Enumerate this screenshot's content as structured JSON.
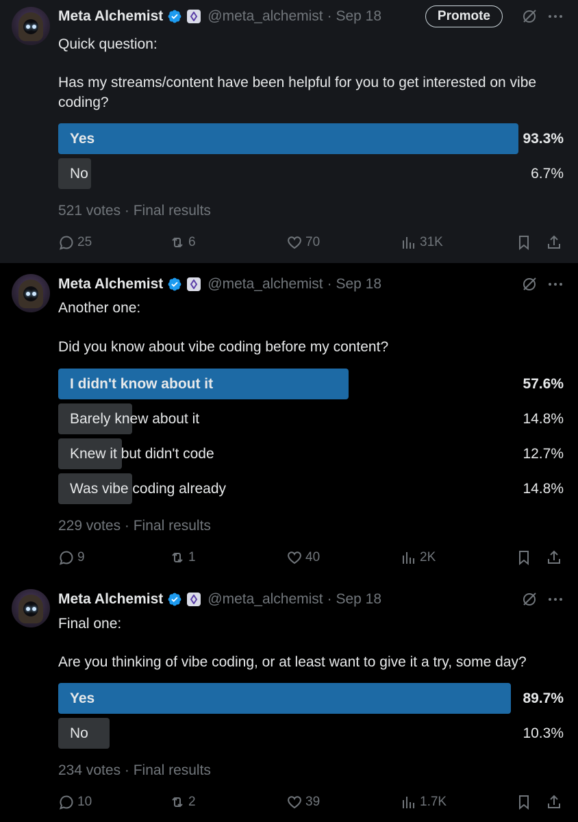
{
  "tweets": [
    {
      "author": {
        "name": "Meta Alchemist",
        "handle": "@meta_alchemist",
        "date": "· Sep 18"
      },
      "promote_label": "Promote",
      "text": [
        "Quick question:",
        "Has my streams/content have been helpful for you to get interested on vibe coding?"
      ],
      "poll": {
        "options": [
          {
            "label": "Yes",
            "percent_text": "93.3%",
            "percent": 93.3,
            "winner": true
          },
          {
            "label": "No",
            "percent_text": "6.7%",
            "percent": 6.7,
            "winner": false
          }
        ],
        "summary": "521 votes · Final results"
      },
      "stats": {
        "replies": "25",
        "reposts": "6",
        "likes": "70",
        "views": "31K"
      }
    },
    {
      "author": {
        "name": "Meta Alchemist",
        "handle": "@meta_alchemist",
        "date": "· Sep 18"
      },
      "text": [
        "Another one:",
        "Did you know about vibe coding before my content?"
      ],
      "poll": {
        "options": [
          {
            "label": "I didn't know about it",
            "percent_text": "57.6%",
            "percent": 57.6,
            "winner": true
          },
          {
            "label": "Barely knew about it",
            "percent_text": "14.8%",
            "percent": 14.8,
            "winner": false
          },
          {
            "label": "Knew it but didn't code",
            "percent_text": "12.7%",
            "percent": 12.7,
            "winner": false
          },
          {
            "label": "Was vibe coding already",
            "percent_text": "14.8%",
            "percent": 14.8,
            "winner": false
          }
        ],
        "summary": "229 votes · Final results"
      },
      "stats": {
        "replies": "9",
        "reposts": "1",
        "likes": "40",
        "views": "2K"
      }
    },
    {
      "author": {
        "name": "Meta Alchemist",
        "handle": "@meta_alchemist",
        "date": "· Sep 18"
      },
      "text": [
        "Final one:",
        "Are you thinking of vibe coding, or at least want to give it a try, some day?"
      ],
      "poll": {
        "options": [
          {
            "label": "Yes",
            "percent_text": "89.7%",
            "percent": 89.7,
            "winner": true
          },
          {
            "label": "No",
            "percent_text": "10.3%",
            "percent": 10.3,
            "winner": false
          }
        ],
        "summary": "234 votes · Final results"
      },
      "stats": {
        "replies": "10",
        "reposts": "2",
        "likes": "39",
        "views": "1.7K"
      }
    }
  ],
  "colors": {
    "background": "#000000",
    "highlight_background": "#16181c",
    "winner_bar": "#1d6aa5",
    "other_bar": "#333639",
    "muted_text": "#71767b",
    "verified_blue": "#1d9bf0"
  },
  "icons": [
    "verified-badge-icon",
    "affiliate-badge-icon",
    "grok-icon",
    "more-icon",
    "reply-icon",
    "repost-icon",
    "like-icon",
    "views-icon",
    "bookmark-icon",
    "share-icon"
  ]
}
